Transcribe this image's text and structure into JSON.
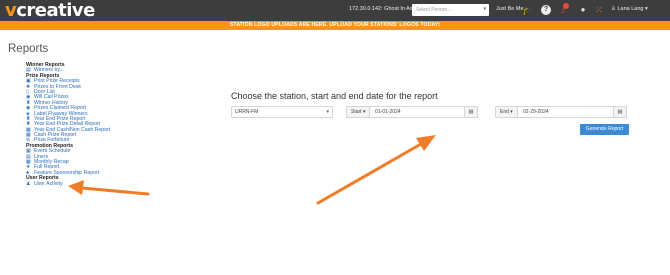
{
  "topbar": {
    "logo_prefix": "v",
    "logo_rest": "creative",
    "ghost_label": "172.30.0.142: Ghost In As",
    "person_placeholder": "Select Person...",
    "caret": "▾",
    "just_be_me": "Just Be Me",
    "user_name": "Lana Lang",
    "icons": [
      "graduation-cap-icon",
      "help-icon",
      "bell-icon",
      "chat-icon",
      "apps-grid-icon",
      "user-icon"
    ]
  },
  "banner": {
    "text": "STATION LOGO UPLOADS ARE HERE. UPLOAD YOUR STATIONS' LOGOS TODAY!"
  },
  "page": {
    "title": "Reports"
  },
  "sidebar": {
    "winner_heading": "Winner Reports",
    "winners_by": "Winners by...",
    "prize_heading": "Prize Reports",
    "prize_items": [
      "Print Prize Receipts",
      "Prizes to Front Desk",
      "Door List",
      "Will Call Prizes",
      "Winner History",
      "Prizes Claimed Report",
      "Label Flyaway Winners",
      "Year End Prize Report",
      "Year End Prize Detail Report",
      "Year End Cash/Non Cash Report",
      "Cash Prize Report",
      "Prize Forfeiture"
    ],
    "promotion_heading": "Promotion Reports",
    "promotion_items": [
      "Event Schedule",
      "Liners",
      "Monthly Recap",
      "Full Report",
      "Feature Sponsorship Report"
    ],
    "user_heading": "User Reports",
    "user_items": [
      "User Activity"
    ]
  },
  "main": {
    "heading": "Choose the station, start and end date for the report",
    "station_value": "URRN-FM",
    "start_label": "Start ▾",
    "start_value": "01-01-2024",
    "end_label": "End ▾",
    "end_value": "02-29-2024",
    "generate_label": "Generate Report"
  },
  "colors": {
    "topbar": "#3d3d3d",
    "accent_orange": "#f7941d",
    "link_blue": "#2a6ebb",
    "button_blue": "#3b8bd4",
    "arrow": "#f07c28"
  }
}
